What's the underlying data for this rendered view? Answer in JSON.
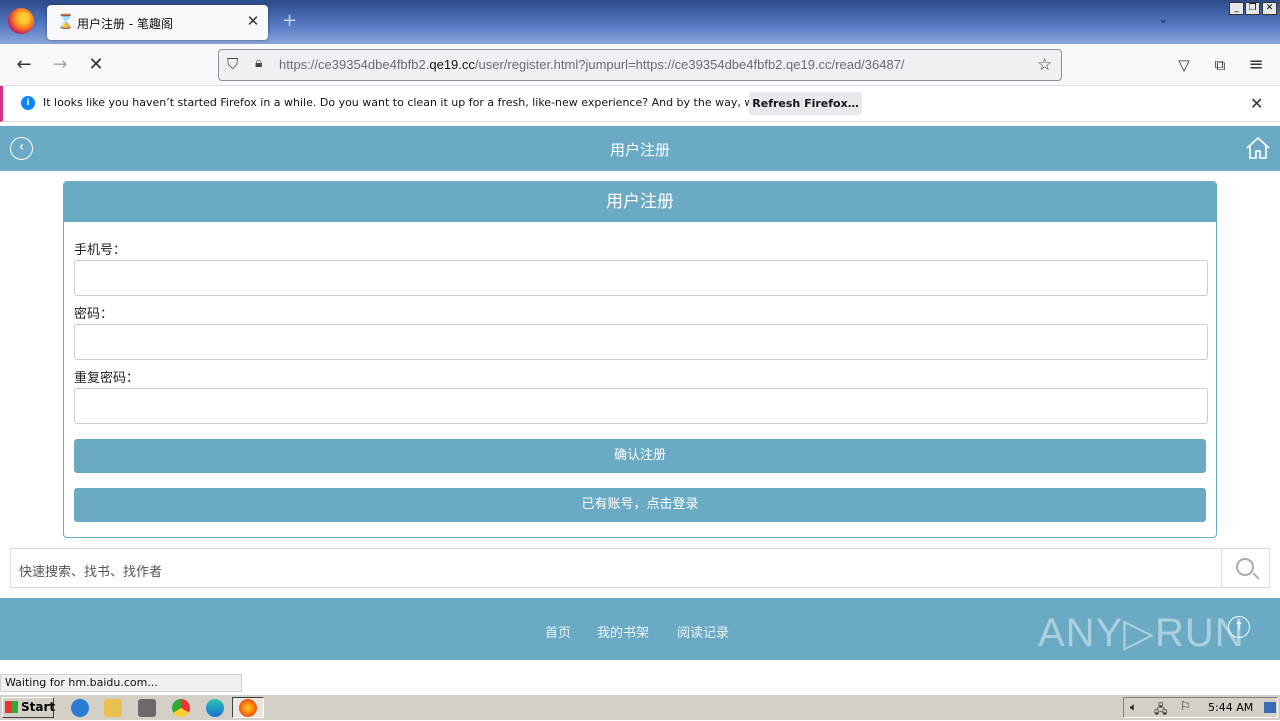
{
  "browser": {
    "tab_title": "用户注册 - 笔趣阁",
    "url_prefix": "https://ce39354dbe4fbfb2.",
    "url_domain": "qe19.cc",
    "url_suffix": "/user/register.html?jumpurl=https://ce39354dbe4fbfb2.qe19.cc/read/36487/",
    "notification_text": "It looks like you haven’t started Firefox in a while. Do you want to clean it up for a fresh, like-new experience? And by the way, welcome back!",
    "notification_button": "Refresh Firefox…",
    "status_text": "Waiting for hm.baidu.com..."
  },
  "page": {
    "header_title": "用户注册",
    "panel_title": "用户注册",
    "fields": [
      {
        "label": "手机号："
      },
      {
        "label": "密码："
      },
      {
        "label": "重复密码："
      }
    ],
    "submit_label": "确认注册",
    "login_label": "已有账号，点击登录",
    "search_placeholder": "快速搜索、找书、找作者",
    "footer_links": [
      "首页",
      "我的书架",
      "阅读记录"
    ],
    "watermark": "ANY▷RUN"
  },
  "taskbar": {
    "start_label": "Start",
    "clock": "5:44 AM"
  }
}
